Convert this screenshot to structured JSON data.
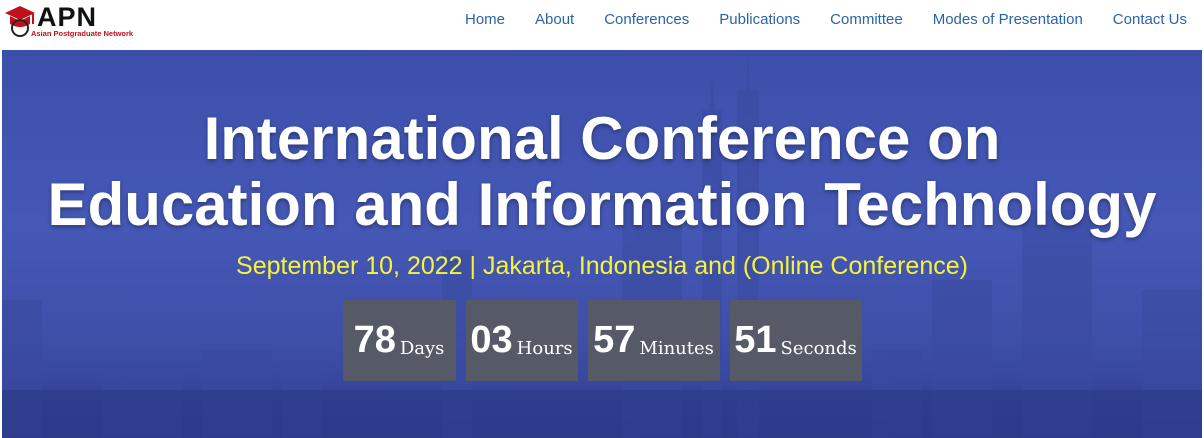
{
  "logo": {
    "name": "APN",
    "subtitle": "Asian Postgraduate Network"
  },
  "nav": [
    "Home",
    "About",
    "Conferences",
    "Publications",
    "Committee",
    "Modes of Presentation",
    "Contact Us"
  ],
  "hero": {
    "title_line1": "International Conference on",
    "title_line2": "Education and Information Technology",
    "subtitle": "September 10, 2022 | Jakarta, Indonesia and (Online Conference)"
  },
  "countdown": [
    {
      "value": "78",
      "unit": "Days"
    },
    {
      "value": "03",
      "unit": "Hours"
    },
    {
      "value": "57",
      "unit": "Minutes"
    },
    {
      "value": "51",
      "unit": "Seconds"
    }
  ],
  "colors": {
    "nav_link": "#2a64a8",
    "subtitle": "#f6f43a",
    "hero_bg": "#4558b6",
    "countdown_box": "#555a66",
    "logo_red": "#c0111a"
  }
}
